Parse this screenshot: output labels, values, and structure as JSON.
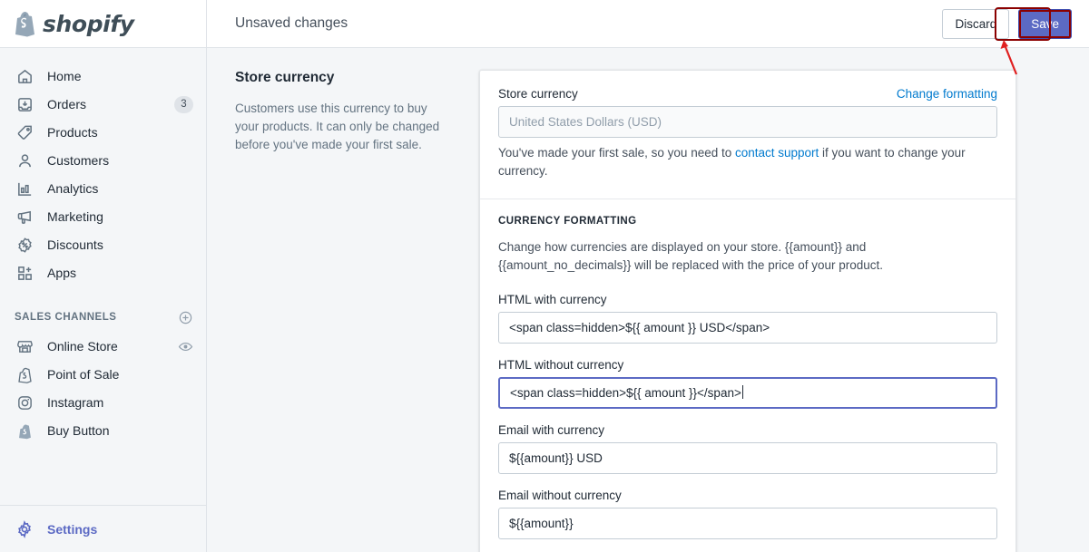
{
  "brand": {
    "name": "shopify",
    "logo_icon": "shopify-bag-icon",
    "accent": "#5c6ac4",
    "link_color": "#007ace"
  },
  "sidebar": {
    "items": [
      {
        "label": "Home",
        "icon": "home-icon",
        "badge": null
      },
      {
        "label": "Orders",
        "icon": "orders-inbox-icon",
        "badge": "3"
      },
      {
        "label": "Products",
        "icon": "tag-icon",
        "badge": null
      },
      {
        "label": "Customers",
        "icon": "person-icon",
        "badge": null
      },
      {
        "label": "Analytics",
        "icon": "bar-chart-icon",
        "badge": null
      },
      {
        "label": "Marketing",
        "icon": "megaphone-icon",
        "badge": null
      },
      {
        "label": "Discounts",
        "icon": "discount-percent-icon",
        "badge": null
      },
      {
        "label": "Apps",
        "icon": "apps-grid-plus-icon",
        "badge": null
      }
    ],
    "sales_channels": {
      "heading": "SALES CHANNELS",
      "add_icon": "circle-plus-icon",
      "items": [
        {
          "label": "Online Store",
          "icon": "storefront-icon",
          "action_icon": "eye-icon"
        },
        {
          "label": "Point of Sale",
          "icon": "shopify-bag-icon",
          "action_icon": null
        },
        {
          "label": "Instagram",
          "icon": "instagram-icon",
          "action_icon": null
        },
        {
          "label": "Buy Button",
          "icon": "shopify-bag-icon",
          "action_icon": null
        }
      ]
    },
    "settings": {
      "label": "Settings",
      "icon": "gear-icon"
    }
  },
  "topbar": {
    "title": "Unsaved changes",
    "discard_label": "Discard",
    "save_label": "Save",
    "highlight_color": "#8b0000"
  },
  "left_panel": {
    "heading": "Store currency",
    "description": "Customers use this currency to buy your products. It can only be changed before you've made your first sale."
  },
  "store_currency": {
    "label": "Store currency",
    "change_formatting_label": "Change formatting",
    "value": "United States Dollars (USD)",
    "help_before": "You've made your first sale, so you need to ",
    "help_link": "contact support",
    "help_after": " if you want to change your currency."
  },
  "currency_formatting": {
    "title": "CURRENCY FORMATTING",
    "description": "Change how currencies are displayed on your store. {{amount}} and {{amount_no_decimals}} will be replaced with the price of your product.",
    "fields": [
      {
        "label": "HTML with currency",
        "value": "<span class=hidden>${{ amount }} USD</span>",
        "focused": false
      },
      {
        "label": "HTML without currency",
        "value": "<span class=hidden>${{ amount }}</span>",
        "focused": true
      },
      {
        "label": "Email with currency",
        "value": "${{amount}} USD",
        "focused": false
      },
      {
        "label": "Email without currency",
        "value": "${{amount}}",
        "focused": false
      }
    ]
  }
}
